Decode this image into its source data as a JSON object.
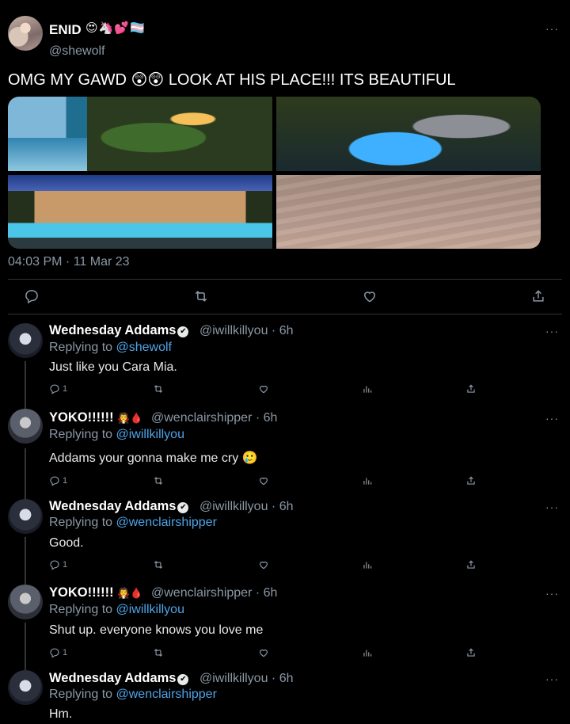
{
  "main_tweet": {
    "author_name": "ENID",
    "author_emoji": "😍🦄💕🏳️‍⚧️",
    "handle": "@shewolf",
    "text": "OMG MY GAWD 😲😲 LOOK AT HIS PLACE!!! ITS BEAUTIFUL",
    "timestamp": "04:03 PM · 11 Mar 23",
    "more": "···",
    "media": [
      "mansion-cliffside-photo",
      "pool-waterfall-photo",
      "villa-pool-night-photo",
      "beach-shore-photo"
    ],
    "actions": [
      "reply-icon",
      "retweet-icon",
      "like-icon",
      "share-icon"
    ]
  },
  "replies": [
    {
      "name": "Wednesday Addams",
      "verified": "✔",
      "meta": "@iwillkillyou · 6h",
      "replying_prefix": "Replying to ",
      "replying_to": "@shewolf",
      "text": "Just like you Cara Mia.",
      "reply_count": "1",
      "more": "···"
    },
    {
      "name": "YOKO!!!!!!",
      "name_emoji": "🧛🩸",
      "meta": "@wenclairshipper · 6h",
      "replying_prefix": "Replying to ",
      "replying_to": "@iwillkillyou",
      "text": "Addams your gonna make me cry 🥲",
      "reply_count": "1",
      "more": "···"
    },
    {
      "name": "Wednesday Addams",
      "verified": "✔",
      "meta": "@iwillkillyou · 6h",
      "replying_prefix": "Replying to ",
      "replying_to": "@wenclairshipper",
      "text": "Good.",
      "reply_count": "1",
      "more": "···"
    },
    {
      "name": "YOKO!!!!!!",
      "name_emoji": "🧛🩸",
      "meta": "@wenclairshipper · 6h",
      "replying_prefix": "Replying to ",
      "replying_to": "@iwillkillyou",
      "text": "Shut up. everyone knows you love me",
      "reply_count": "1",
      "more": "···"
    },
    {
      "name": "Wednesday Addams",
      "verified": "✔",
      "meta": "@iwillkillyou · 6h",
      "replying_prefix": "Replying to ",
      "replying_to": "@wenclairshipper",
      "text": "Hm.",
      "more": "···"
    }
  ],
  "colors": {
    "background": "#000000",
    "text": "#e7e9ea",
    "muted": "#8b98a5",
    "mention": "#4ea4e8",
    "divider": "#2f3336"
  }
}
